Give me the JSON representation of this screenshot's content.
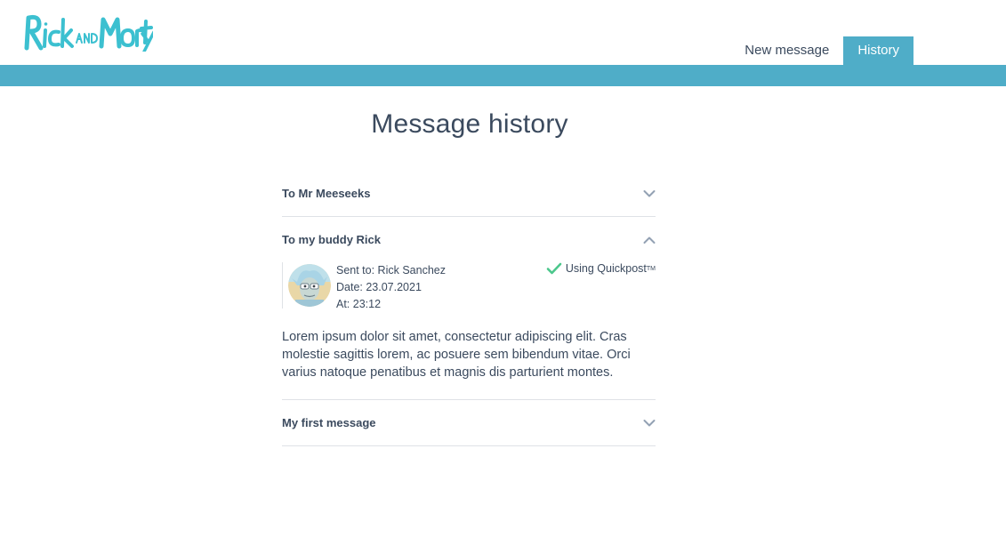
{
  "brand": {
    "logo_text": "Rick and Morty",
    "accent": "#4fadc8"
  },
  "nav": {
    "items": [
      {
        "label": "New message",
        "active": false
      },
      {
        "label": "History",
        "active": true
      }
    ]
  },
  "page": {
    "title": "Message history"
  },
  "messages": [
    {
      "title": "To Mr Meeseeks",
      "expanded": false,
      "icon": "chevron-down-icon"
    },
    {
      "title": "To my buddy Rick",
      "expanded": true,
      "icon": "chevron-up-icon",
      "sent_to": "Sent to: Rick Sanchez",
      "date": "Date: 23.07.2021",
      "time": "At: 23:12",
      "method": "Using Quickpost",
      "method_mark": "TM",
      "method_icon": "checkmark-icon",
      "body": "Lorem ipsum dolor sit amet, consectetur adipiscing elit. Cras molestie sagittis lorem, ac posuere sem bibendum vitae. Orci varius natoque penatibus et magnis dis parturient montes."
    },
    {
      "title": "My first message",
      "expanded": false,
      "icon": "chevron-down-icon"
    }
  ]
}
